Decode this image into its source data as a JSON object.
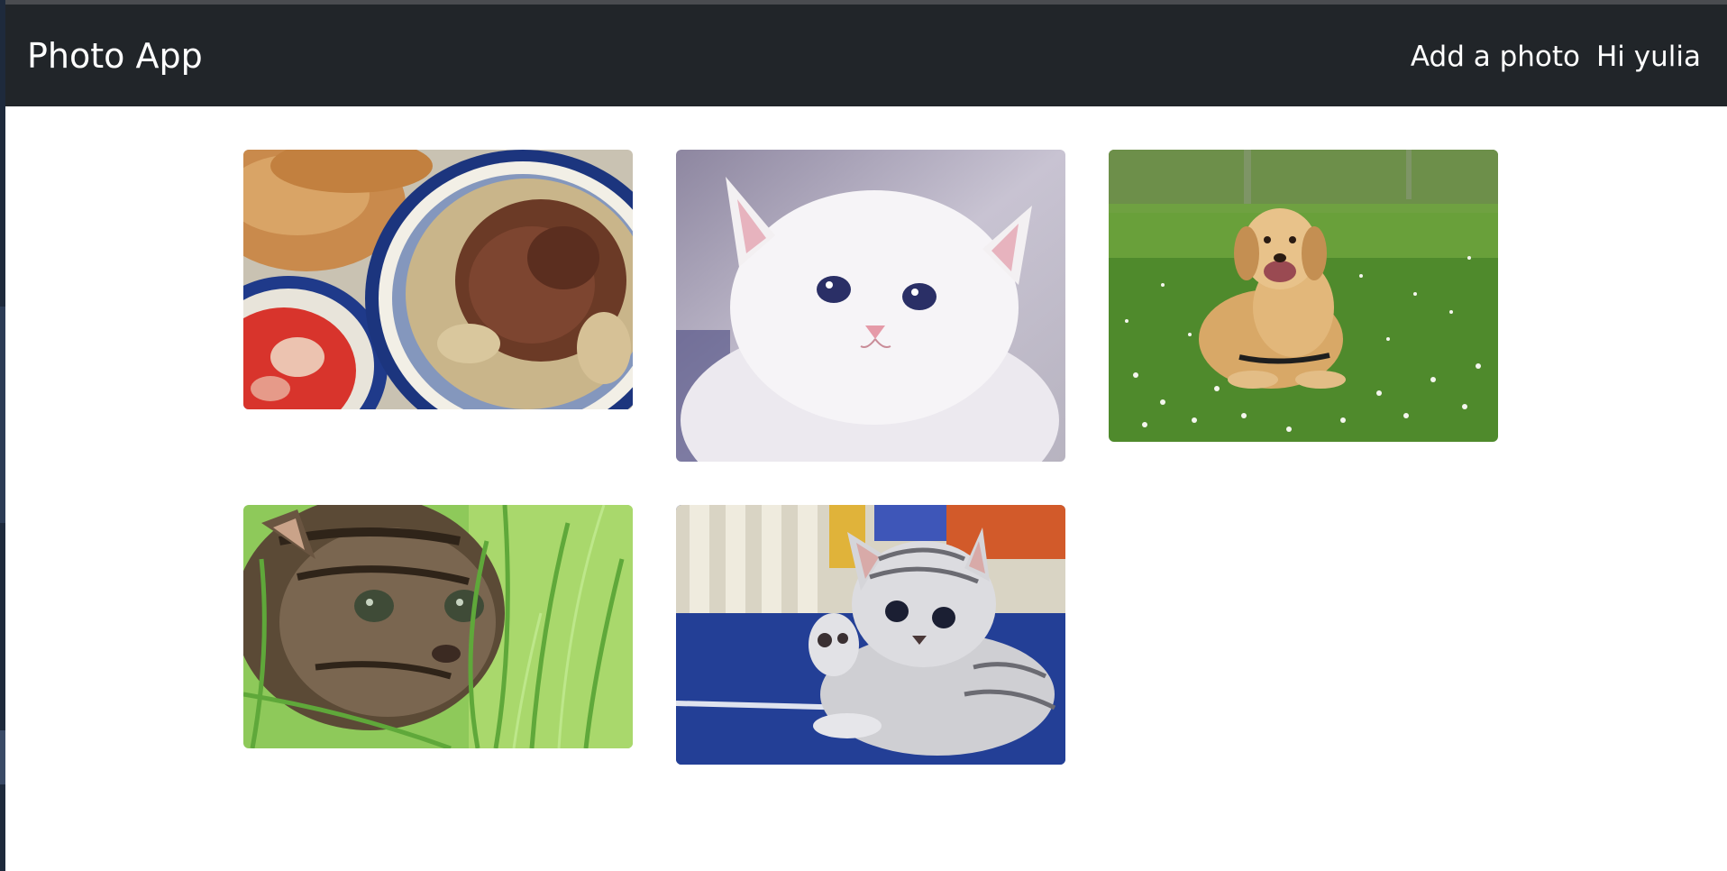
{
  "navbar": {
    "brand": "Photo App",
    "add_photo": "Add a photo",
    "greeting": "Hi yulia"
  },
  "photos": [
    {
      "subject": "plov-with-beef-and-tomato-salad"
    },
    {
      "subject": "white-kitten-blue-eyes"
    },
    {
      "subject": "golden-retriever-in-daisy-field"
    },
    {
      "subject": "tabby-kitten-in-grass"
    },
    {
      "subject": "grey-tabby-kitten-on-blue-blanket"
    }
  ],
  "colors": {
    "navbar_bg": "#212529",
    "navbar_text": "#ffffff",
    "page_bg": "#ffffff"
  }
}
